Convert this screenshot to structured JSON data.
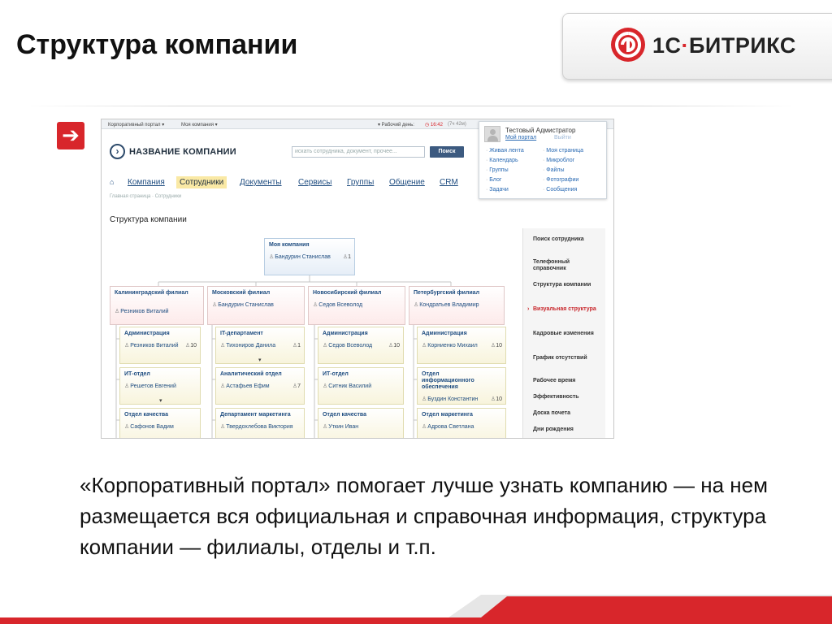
{
  "slide": {
    "title": "Структура компании",
    "caption": "«Корпоративный портал» помогает лучше узнать компанию — на нем размещается вся официальная и справочная информация, структура компании — филиалы, отделы и т.п.",
    "logo": {
      "prefix": "1С",
      "dot": "·",
      "name": "БИТРИКС"
    },
    "arrow_icon": "➔",
    "colors": {
      "accent": "#d8262b"
    }
  },
  "portal": {
    "topbar": {
      "portal_menu": "Корпоративный портал ▾",
      "company_menu": "Моя компания ▾",
      "workday": "▾ Рабочий день:",
      "time": "◷ 16:42",
      "extra": "(7ч 42м)"
    },
    "user_panel": {
      "name": "Тестовый Адмистратор",
      "portal_link": "Мой портал",
      "logout_link": "Выйти",
      "links_left": [
        "Живая лента",
        "Календарь",
        "Группы",
        "Блог",
        "Задачи"
      ],
      "links_right": [
        "Моя страница",
        "Микроблог",
        "Файлы",
        "Фотографии",
        "Сообщения"
      ]
    },
    "header": {
      "company_name": "НАЗВАНИЕ КОМПАНИИ",
      "search_placeholder": "искать сотрудника, документ, прочее...",
      "search_button": "Поиск"
    },
    "nav": {
      "home_icon": "⌂",
      "items": [
        "Компания",
        "Сотрудники",
        "Документы",
        "Сервисы",
        "Группы",
        "Общение",
        "CRM"
      ]
    },
    "breadcrumb": "Главная страница · Сотрудники",
    "page_title": "Структура компании",
    "sidebar": [
      "Поиск сотрудника",
      "Телефонный справочник",
      "Структура компании",
      "Визуальная структура",
      "Кадровые изменения",
      "График отсутствий",
      "Рабочее время",
      "Эффективность",
      "Доска почета",
      "Дни рождения"
    ],
    "org": {
      "root": {
        "name": "Моя компания",
        "head": "Бандурин Станислав",
        "count": "1"
      },
      "branches": [
        {
          "name": "Калининградский филиал",
          "head": "Резников Виталий"
        },
        {
          "name": "Московский филиал",
          "head": "Бандурин Станислав"
        },
        {
          "name": "Новосибирский филиал",
          "head": "Седов Всеволод"
        },
        {
          "name": "Петербургский филиал",
          "head": "Кондратьев Владимир"
        }
      ],
      "departments": [
        [
          {
            "name": "Администрация",
            "head": "Резников Виталий",
            "count": "10"
          },
          {
            "name": "ИТ-отдел",
            "head": "Решетов Евгений",
            "count": "",
            "toggle": "▾"
          },
          {
            "name": "Отдел качества",
            "head": "Сафонов Вадим",
            "count": ""
          }
        ],
        [
          {
            "name": "IT-департамент",
            "head": "Тихониров Данила",
            "count": "1",
            "toggle": "▾"
          },
          {
            "name": "Аналитический отдел",
            "head": "Астафьев Ефим",
            "count": "7"
          },
          {
            "name": "Департамент маркетинга",
            "head": "Твердохлебова Виктория",
            "count": ""
          }
        ],
        [
          {
            "name": "Администрация",
            "head": "Седов Всеволод",
            "count": "10"
          },
          {
            "name": "ИТ-отдел",
            "head": "Ситник Василий",
            "count": ""
          },
          {
            "name": "Отдел качества",
            "head": "Уткин Иван",
            "count": ""
          }
        ],
        [
          {
            "name": "Администрация",
            "head": "Корниенко Михаил",
            "count": "10"
          },
          {
            "name": "Отдел информационного обеспечения",
            "head": "Буздин Константин",
            "count": "10"
          },
          {
            "name": "Отдел маркетинга",
            "head": "Адрова Светлана",
            "count": ""
          }
        ]
      ]
    }
  }
}
